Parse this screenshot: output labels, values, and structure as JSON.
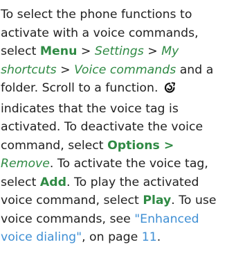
{
  "paragraph": {
    "lines": [
      [
        "To select the phone functions to"
      ],
      [
        "activate with a voice commands,"
      ],
      [
        "select ",
        "Menu",
        " > ",
        "Settings",
        " > ",
        "My"
      ],
      [
        "shortcuts",
        " > ",
        "Voice commands",
        " and a"
      ],
      [
        "folder. Scroll to a function. "
      ],
      [
        "indicates that the voice tag is"
      ],
      [
        "activated. To deactivate the voice"
      ],
      [
        "command, select ",
        "Options",
        " >"
      ],
      [
        "Remove",
        ". To activate the voice tag,"
      ],
      [
        "select ",
        "Add",
        ". To play the activated"
      ],
      [
        "voice command, select ",
        "Play",
        ". To use"
      ],
      [
        "voice commands, see ",
        "\"Enhanced"
      ],
      [
        "voice dialing\"",
        ", on page ",
        "11",
        "."
      ]
    ],
    "voice_tag_icon": "voice-tag-icon"
  },
  "colors": {
    "body_text": "#222222",
    "menu_command": "#2f8a44",
    "cross_reference": "#3f8fd4"
  }
}
